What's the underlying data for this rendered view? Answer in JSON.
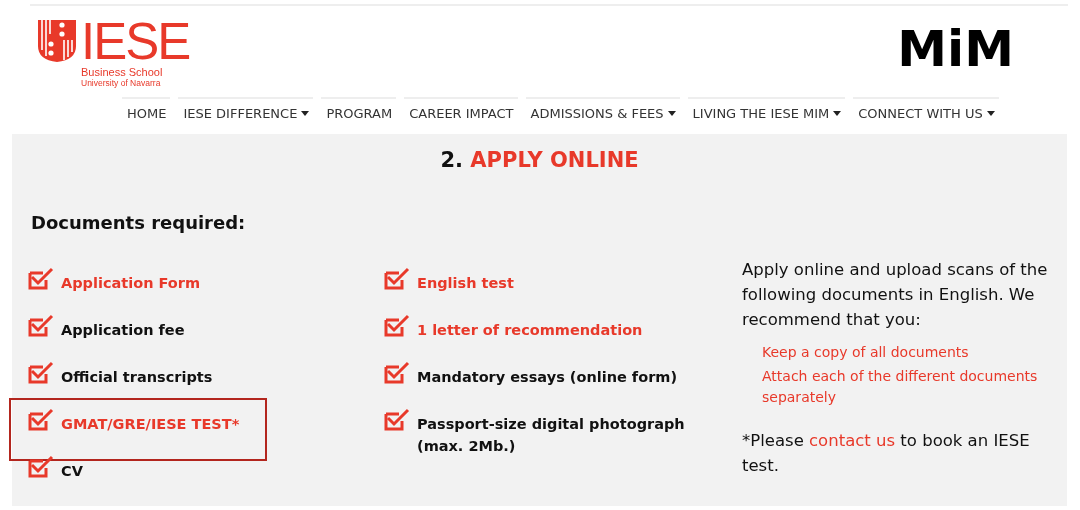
{
  "logo": {
    "name": "IESE",
    "line_1": "Business School",
    "line_2": "University of Navarra"
  },
  "program_logo": "MiM",
  "nav": [
    {
      "label": "HOME",
      "dropdown": false
    },
    {
      "label": "IESE DIFFERENCE",
      "dropdown": true
    },
    {
      "label": "PROGRAM",
      "dropdown": false
    },
    {
      "label": "CAREER IMPACT",
      "dropdown": false
    },
    {
      "label": "ADMISSIONS & FEES",
      "dropdown": true
    },
    {
      "label": "LIVING THE IESE MIM",
      "dropdown": true
    },
    {
      "label": "CONNECT WITH US",
      "dropdown": true
    }
  ],
  "section": {
    "number": "2.",
    "title": "APPLY ONLINE"
  },
  "documents_heading": "Documents required:",
  "documents": [
    [
      {
        "label": "Application Form",
        "linked": true,
        "highlighted": false
      },
      {
        "label": "Application fee",
        "linked": false,
        "highlighted": false
      },
      {
        "label": "Official transcripts",
        "linked": false,
        "highlighted": false
      },
      {
        "label": "GMAT/GRE/IESE TEST*",
        "linked": true,
        "highlighted": true
      },
      {
        "label": "CV",
        "linked": false,
        "highlighted": false
      }
    ],
    [
      {
        "label": "English test",
        "linked": true,
        "highlighted": false
      },
      {
        "label": "1 letter of recommendation",
        "linked": true,
        "highlighted": false
      },
      {
        "label": "Mandatory essays (online form)",
        "linked": false,
        "highlighted": false
      },
      {
        "label": "Passport-size digital photograph (max. 2Mb.)",
        "linked": false,
        "highlighted": false
      }
    ]
  ],
  "intro": "Apply online and upload scans of the following documents in English. We recommend that you:",
  "recommendations": [
    "Keep a copy of all documents",
    "Attach each of the different documents separately"
  ],
  "note": {
    "before": "*Please",
    "link": "contact us",
    "after": "to book an IESE test."
  }
}
